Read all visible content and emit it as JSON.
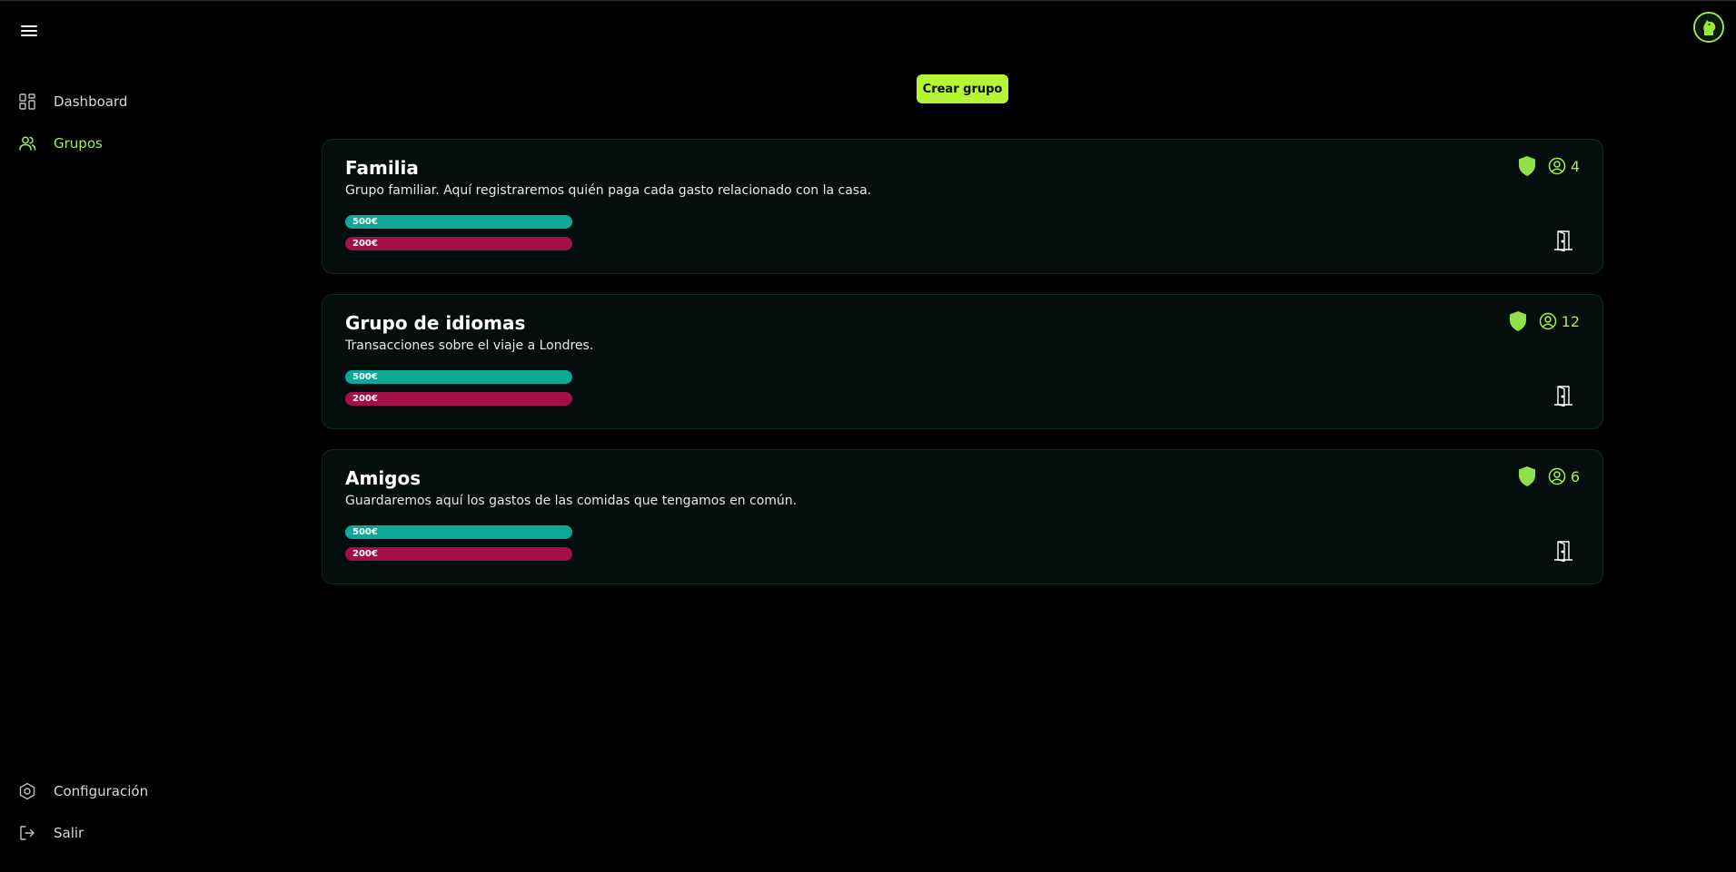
{
  "header": {
    "menu_icon": "hamburger-menu-icon",
    "avatar_icon": "horse-knight-logo-icon"
  },
  "sidebar": {
    "top_items": [
      {
        "label": "Dashboard",
        "icon": "dashboard-grid-icon",
        "active": false
      },
      {
        "label": "Grupos",
        "icon": "users-icon",
        "active": true
      }
    ],
    "bottom_items": [
      {
        "label": "Configuración",
        "icon": "settings-hexagon-icon"
      },
      {
        "label": "Salir",
        "icon": "logout-icon"
      }
    ]
  },
  "main": {
    "create_button_label": "Crear grupo",
    "groups": [
      {
        "title": "Familia",
        "description": "Grupo familiar. Aquí registraremos quién paga cada gasto relacionado con la casa.",
        "income": "500€",
        "expense": "200€",
        "members": "4"
      },
      {
        "title": "Grupo de idiomas",
        "description": "Transacciones sobre el viaje a Londres.",
        "income": "500€",
        "expense": "200€",
        "members": "12"
      },
      {
        "title": "Amigos",
        "description": "Guardaremos aquí los gastos de las comidas que tengamos en común.",
        "income": "500€",
        "expense": "200€",
        "members": "6"
      }
    ]
  },
  "colors": {
    "accent": "#a6f03f",
    "button": "#b4f535",
    "income_bar": "#0ea898",
    "expense_bar": "#a50f47",
    "card_bg": "#040e0c"
  }
}
